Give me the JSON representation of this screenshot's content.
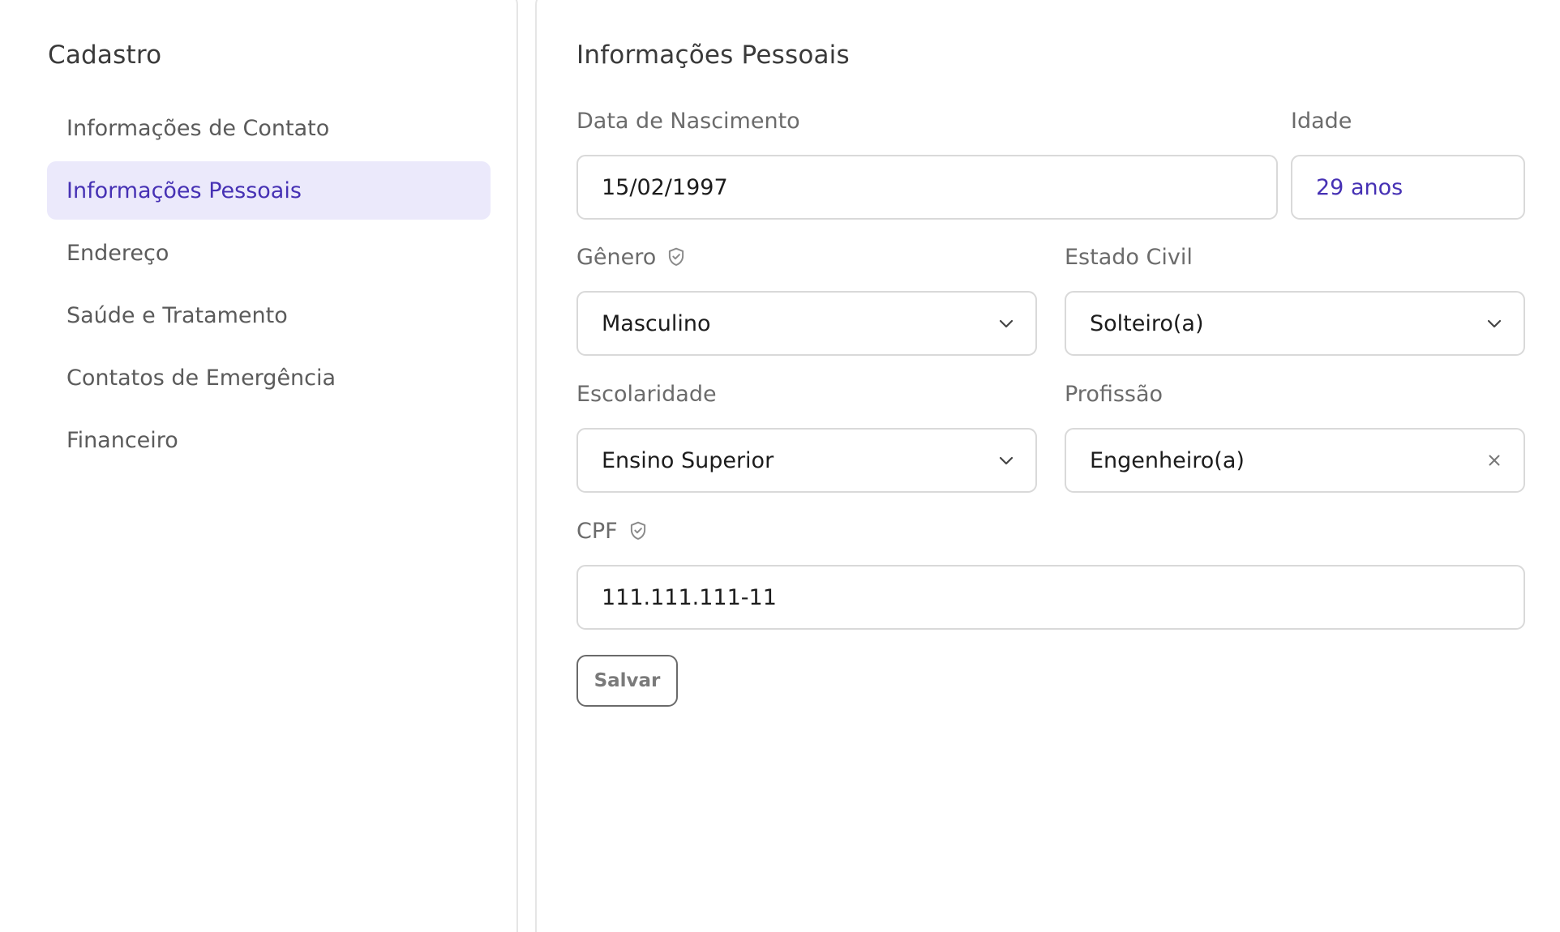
{
  "sidebar": {
    "title": "Cadastro",
    "items": [
      {
        "label": "Informações de Contato",
        "active": false
      },
      {
        "label": "Informações Pessoais",
        "active": true
      },
      {
        "label": "Endereço",
        "active": false
      },
      {
        "label": "Saúde e Tratamento",
        "active": false
      },
      {
        "label": "Contatos de Emergência",
        "active": false
      },
      {
        "label": "Financeiro",
        "active": false
      }
    ]
  },
  "main": {
    "title": "Informações Pessoais",
    "fields": {
      "birth_date": {
        "label": "Data de Nascimento",
        "value": "15/02/1997"
      },
      "age": {
        "label": "Idade",
        "value": "29 anos"
      },
      "gender": {
        "label": "Gênero",
        "value": "Masculino",
        "icon": "shield-check-icon"
      },
      "marital_status": {
        "label": "Estado Civil",
        "value": "Solteiro(a)"
      },
      "education": {
        "label": "Escolaridade",
        "value": "Ensino Superior"
      },
      "profession": {
        "label": "Profissão",
        "value": "Engenheiro(a)"
      },
      "cpf": {
        "label": "CPF",
        "value": "111.111.111-11",
        "icon": "shield-check-icon"
      }
    },
    "save_label": "Salvar"
  },
  "colors": {
    "accent": "#4631b4",
    "active_bg": "#ebe9fb",
    "border": "#d9d9d9"
  }
}
